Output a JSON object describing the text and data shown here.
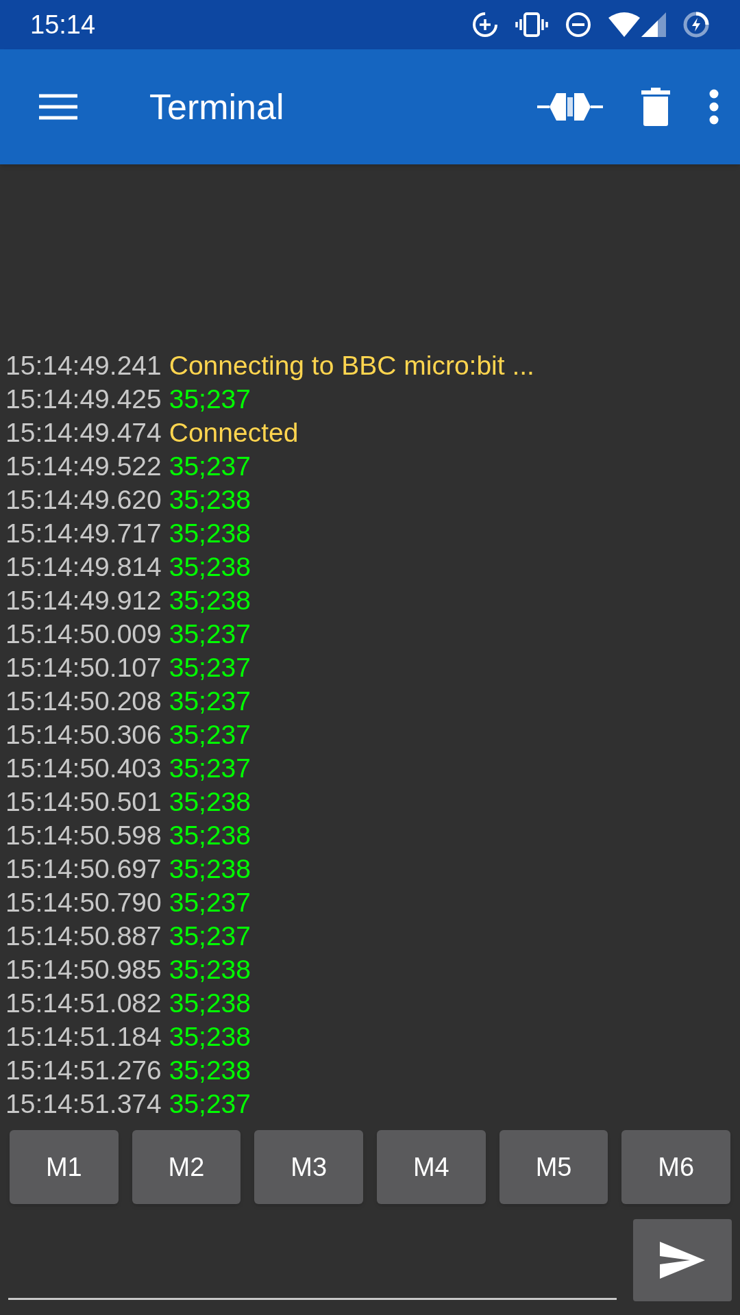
{
  "status_bar": {
    "time": "15:14"
  },
  "app_bar": {
    "title": "Terminal"
  },
  "log": [
    {
      "time": "15:14:49.241",
      "kind": "status",
      "text": "Connecting to BBC micro:bit ..."
    },
    {
      "time": "15:14:49.425",
      "kind": "data",
      "text": "35;237"
    },
    {
      "time": "15:14:49.474",
      "kind": "status",
      "text": "Connected"
    },
    {
      "time": "15:14:49.522",
      "kind": "data",
      "text": "35;237"
    },
    {
      "time": "15:14:49.620",
      "kind": "data",
      "text": "35;238"
    },
    {
      "time": "15:14:49.717",
      "kind": "data",
      "text": "35;238"
    },
    {
      "time": "15:14:49.814",
      "kind": "data",
      "text": "35;238"
    },
    {
      "time": "15:14:49.912",
      "kind": "data",
      "text": "35;238"
    },
    {
      "time": "15:14:50.009",
      "kind": "data",
      "text": "35;237"
    },
    {
      "time": "15:14:50.107",
      "kind": "data",
      "text": "35;237"
    },
    {
      "time": "15:14:50.208",
      "kind": "data",
      "text": "35;237"
    },
    {
      "time": "15:14:50.306",
      "kind": "data",
      "text": "35;237"
    },
    {
      "time": "15:14:50.403",
      "kind": "data",
      "text": "35;237"
    },
    {
      "time": "15:14:50.501",
      "kind": "data",
      "text": "35;238"
    },
    {
      "time": "15:14:50.598",
      "kind": "data",
      "text": "35;238"
    },
    {
      "time": "15:14:50.697",
      "kind": "data",
      "text": "35;238"
    },
    {
      "time": "15:14:50.790",
      "kind": "data",
      "text": "35;237"
    },
    {
      "time": "15:14:50.887",
      "kind": "data",
      "text": "35;237"
    },
    {
      "time": "15:14:50.985",
      "kind": "data",
      "text": "35;238"
    },
    {
      "time": "15:14:51.082",
      "kind": "data",
      "text": "35;238"
    },
    {
      "time": "15:14:51.184",
      "kind": "data",
      "text": "35;238"
    },
    {
      "time": "15:14:51.276",
      "kind": "data",
      "text": "35;238"
    },
    {
      "time": "15:14:51.374",
      "kind": "data",
      "text": "35;237"
    }
  ],
  "macro_buttons": [
    "M1",
    "M2",
    "M3",
    "M4",
    "M5",
    "M6"
  ]
}
